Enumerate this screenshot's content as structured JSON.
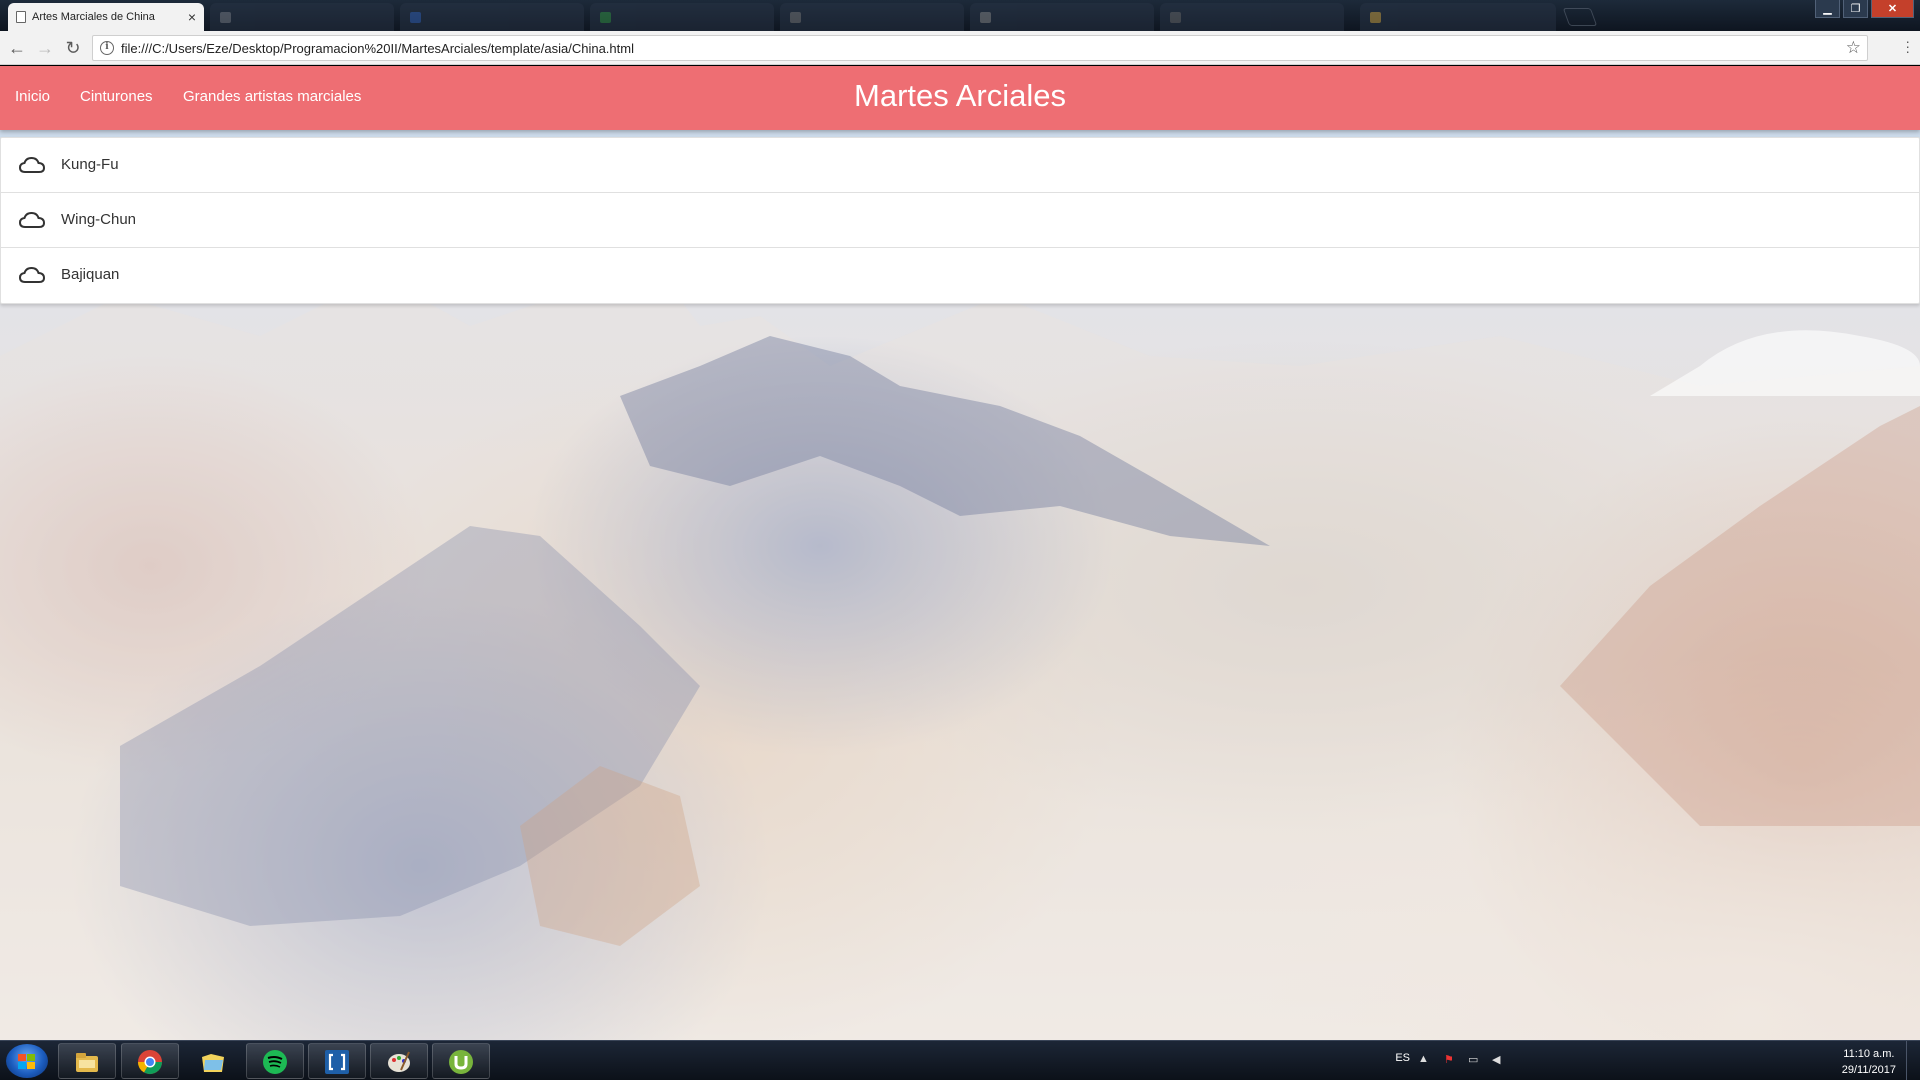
{
  "browser": {
    "tabs": [
      {
        "title": "Artes Marciales de China",
        "active": true
      },
      {
        "title": "",
        "active": false
      },
      {
        "title": "",
        "active": false
      },
      {
        "title": "",
        "active": false
      },
      {
        "title": "",
        "active": false
      },
      {
        "title": "",
        "active": false
      },
      {
        "title": "",
        "active": false
      },
      {
        "title": "",
        "active": false
      }
    ],
    "close_glyph": "×",
    "url": "file:///C:/Users/Eze/Desktop/Programacion%20II/MartesArciales/template/asia/China.html"
  },
  "navbar": {
    "links": [
      "Inicio",
      "Cinturones",
      "Grandes artistas marciales"
    ],
    "brand": "Martes Arciales",
    "color": "#ee6e73"
  },
  "collection": {
    "items": [
      {
        "label": "Kung-Fu",
        "icon": "cloud-icon"
      },
      {
        "label": "Wing-Chun",
        "icon": "cloud-icon"
      },
      {
        "label": "Bajiquan",
        "icon": "cloud-icon"
      }
    ]
  },
  "taskbar": {
    "apps": [
      "windows-explorer-icon",
      "chrome-icon",
      "folder-icon",
      "spotify-icon",
      "brackets-icon",
      "paint-icon",
      "utorrent-icon"
    ],
    "language": "ES",
    "time": "11:10 a.m.",
    "date": "29/11/2017"
  }
}
